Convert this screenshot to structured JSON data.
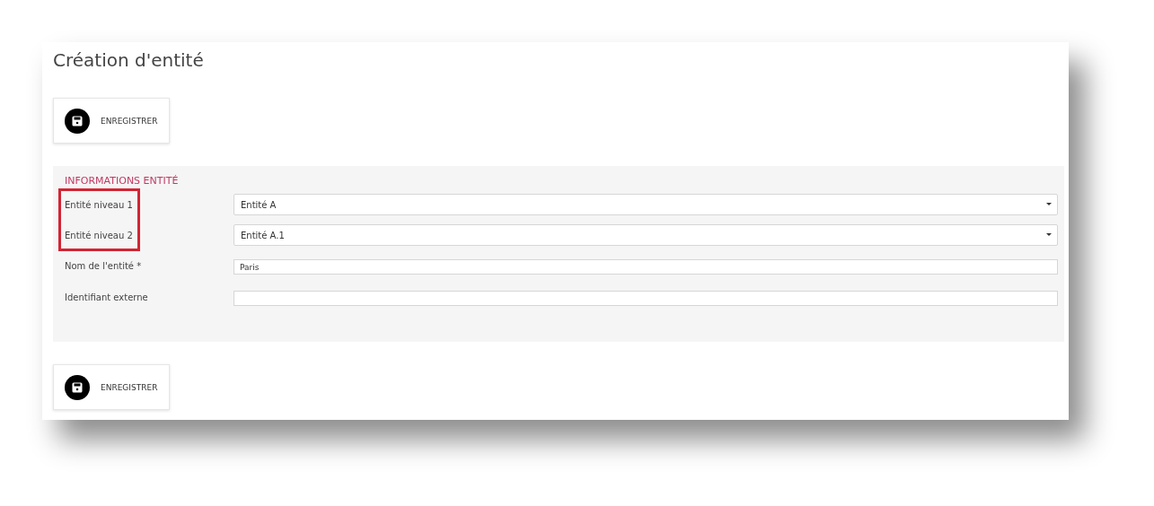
{
  "page": {
    "title": "Création d'entité"
  },
  "save_buttons": [
    {
      "label": "ENREGISTRER"
    },
    {
      "label": "ENREGISTRER"
    }
  ],
  "section": {
    "title": "INFORMATIONS ENTITÉ",
    "fields": [
      {
        "label": "Entité niveau 1",
        "kind": "select",
        "value": "Entité A",
        "highlighted": true
      },
      {
        "label": "Entité niveau 2",
        "kind": "select",
        "value": "Entité A.1",
        "highlighted": true
      },
      {
        "label": "Nom de l'entité *",
        "kind": "text",
        "value": "Paris",
        "highlighted": false
      },
      {
        "label": "Identifiant externe",
        "kind": "text",
        "highlighted": false
      }
    ]
  }
}
